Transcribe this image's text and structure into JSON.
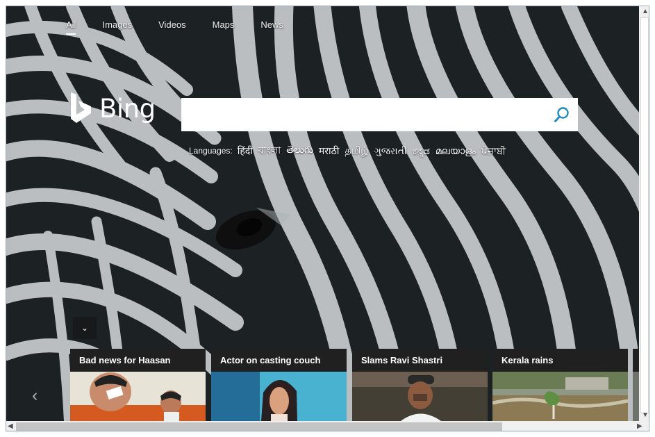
{
  "nav": {
    "items": [
      "All",
      "Images",
      "Videos",
      "Maps",
      "News"
    ]
  },
  "brand": {
    "name": "Bing"
  },
  "search": {
    "value": "",
    "placeholder": ""
  },
  "languages": {
    "label": "Languages:",
    "items": [
      "हिंदी",
      "বাংলা",
      "తెలుగు",
      "मराठी",
      "தமிழ்",
      "ગુજરાતી",
      "ಕನ್ನಡ",
      "മലയാളം",
      "ਪੰਜਾਬੀ"
    ]
  },
  "news": {
    "items": [
      {
        "title": "Bad news for Haasan"
      },
      {
        "title": "Actor on casting couch"
      },
      {
        "title": "Slams Ravi Shastri"
      },
      {
        "title": "Kerala rains"
      },
      {
        "title": ""
      }
    ]
  },
  "icons": {
    "search": "search-icon",
    "collapse": "chevron-down-icon",
    "carousel_prev": "chevron-left-icon"
  },
  "colors": {
    "search_icon": "#1b8bbf",
    "hero_dark": "#202426",
    "card_bg": "#202020"
  }
}
